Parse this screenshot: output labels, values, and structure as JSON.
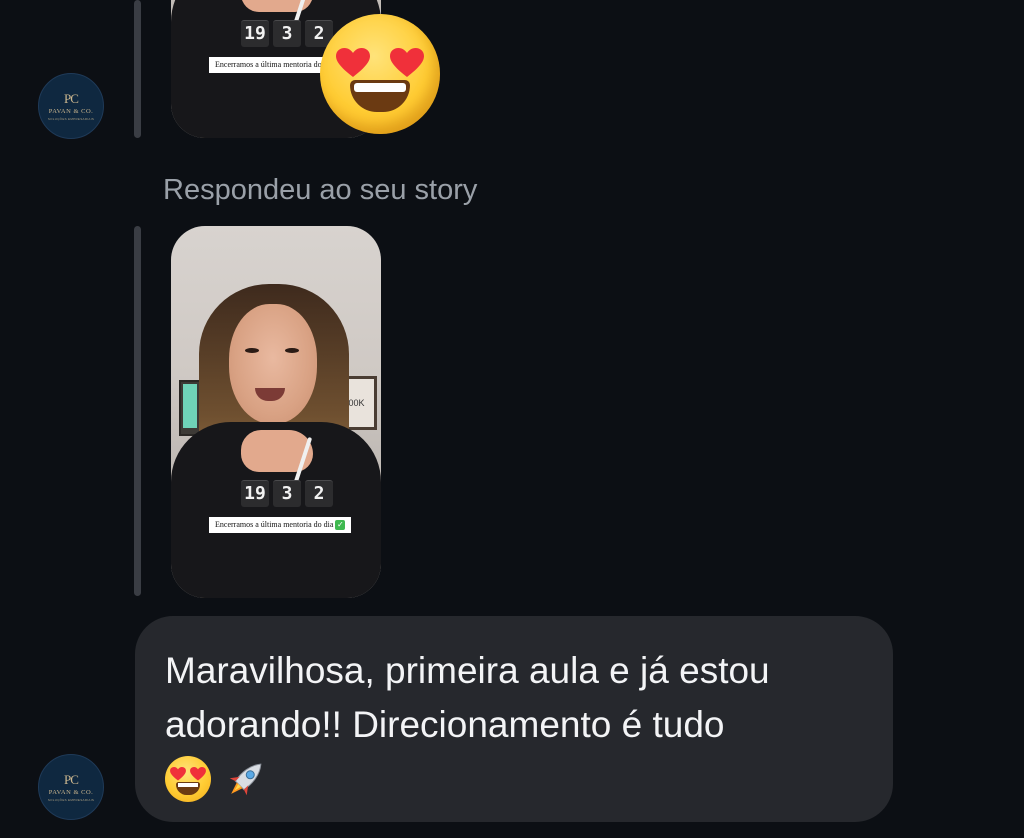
{
  "thread": {
    "first_story": {
      "timer_digits": [
        "19",
        "3",
        "2"
      ],
      "caption": "Encerramos a última mentoria do d"
    },
    "reaction_emoji": "heart-eyes",
    "reply_label": "Respondeu ao seu story",
    "second_story": {
      "timer_digits": [
        "19",
        "3",
        "2"
      ],
      "caption": "Encerramos a última mentoria do dia",
      "frame_text": "200K"
    },
    "message": {
      "text": "Maravilhosa, primeira aula e já estou\nadorando!! Direcionamento é tudo",
      "emojis": [
        "😍",
        "🚀"
      ]
    }
  },
  "avatar": {
    "monogram": "PC",
    "name": "PAVAN & CO.",
    "tagline": "SOLUÇÕES EMPRESARIAIS"
  },
  "colors": {
    "background": "#0c0f14",
    "bubble": "#26282d",
    "reply_label": "#9aa0a8",
    "avatar_bg": "#0f2840",
    "avatar_gold": "#cdb88f"
  }
}
